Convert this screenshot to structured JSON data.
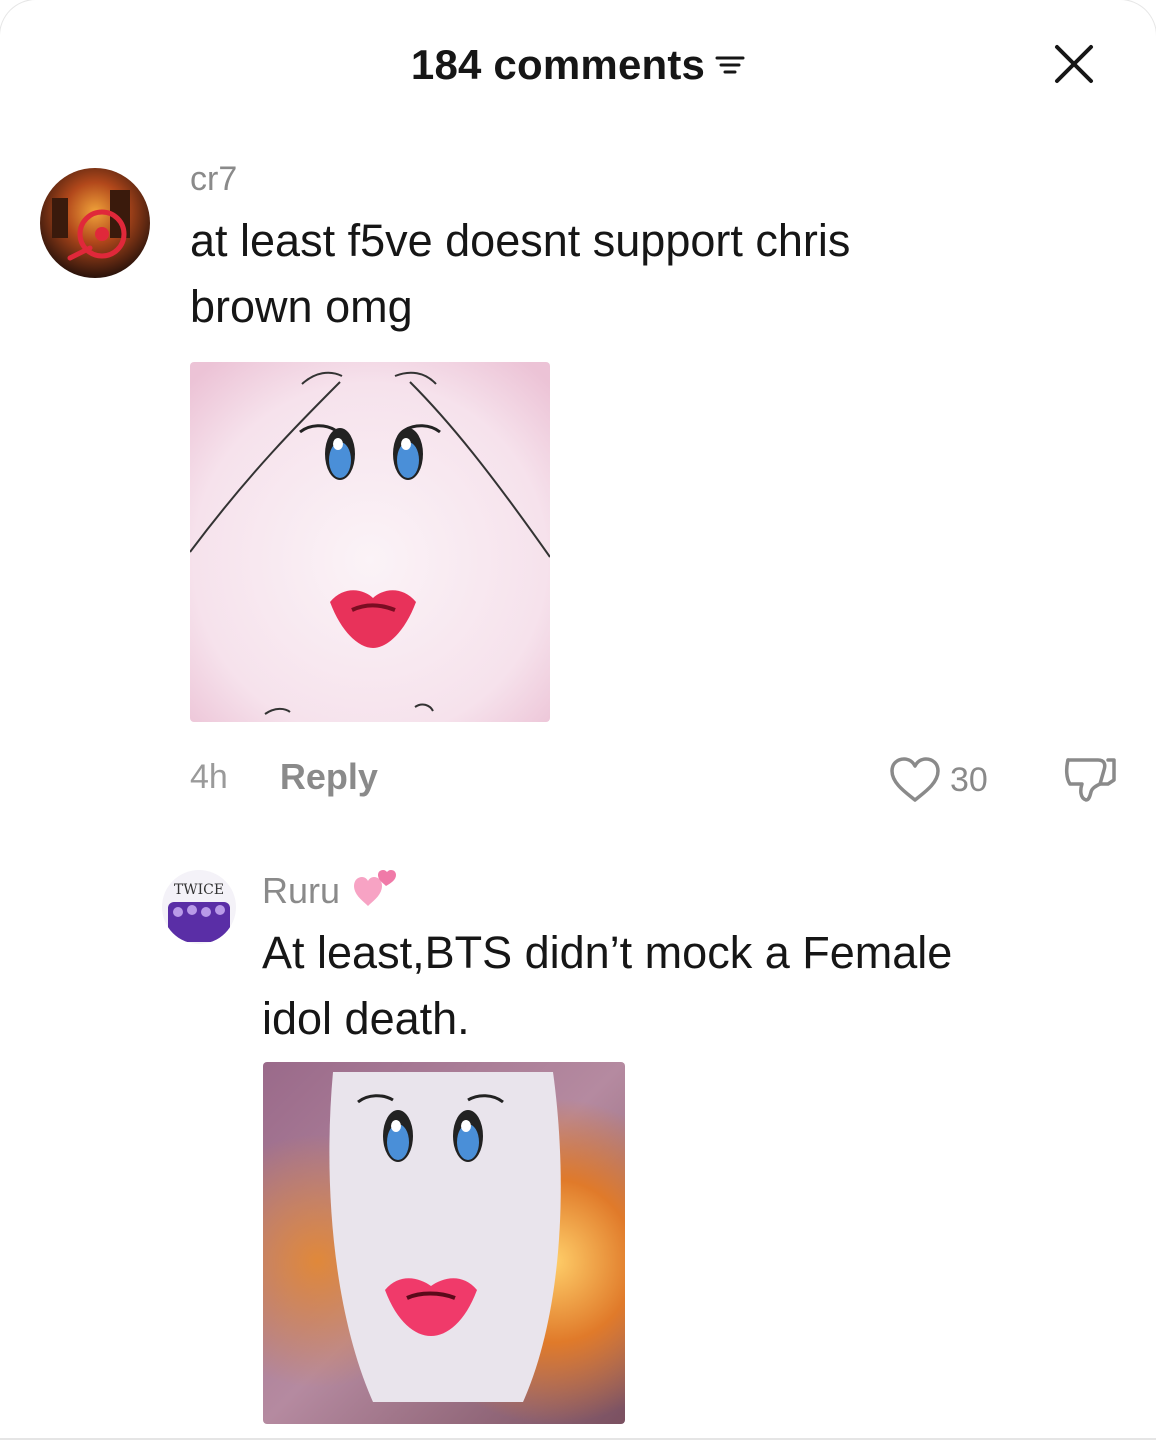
{
  "header": {
    "title": "184 comments",
    "filter_icon": "filter-lines-icon",
    "close_icon": "close-icon"
  },
  "comments": [
    {
      "username": "cr7",
      "text_line1": "at least f5ve doesnt support chris",
      "text_line2": "brown omg",
      "sticker": "cartoon-face-sticker",
      "time": "4h",
      "reply_label": "Reply",
      "likes": "30"
    },
    {
      "username": "Ruru",
      "badge": "two-hearts-emoji",
      "text_line1": "At least,BTS didn’t mock a Female",
      "text_line2": "idol death.",
      "sticker": "cartoon-face-fire-sticker",
      "avatar_text": "TWICE"
    }
  ],
  "colors": {
    "text": "#161616",
    "muted": "#8a8a8a",
    "lips": "#e8325a",
    "eyes": "#3b6fd0"
  }
}
